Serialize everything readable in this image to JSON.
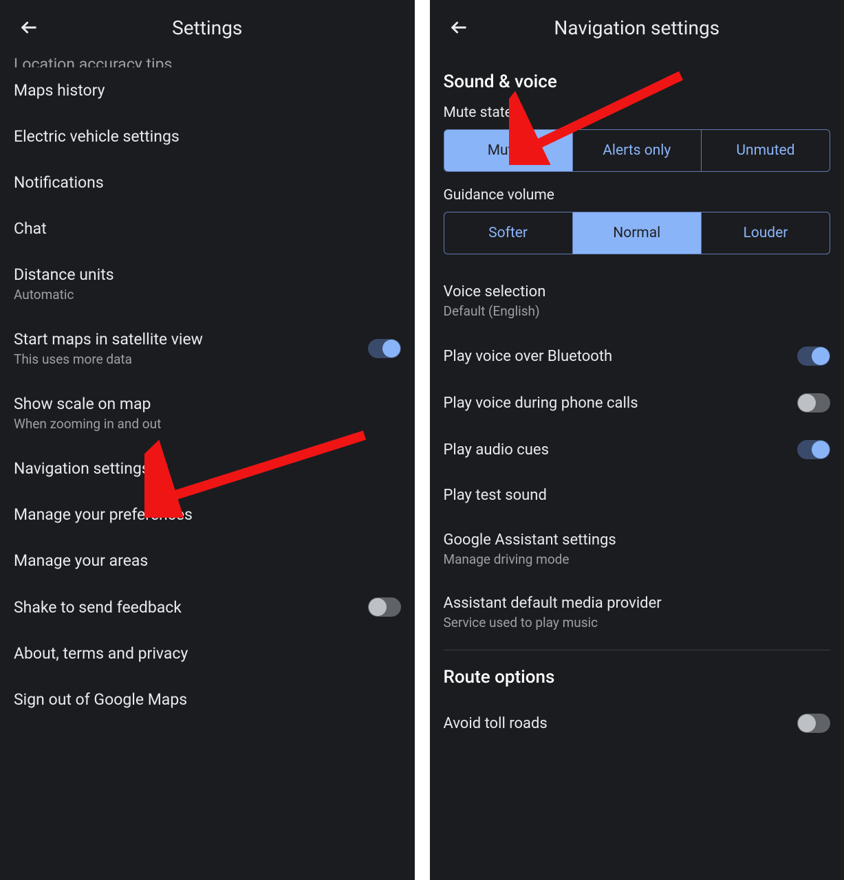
{
  "left": {
    "title": "Settings",
    "cutoff": "Location accuracy tips",
    "items": [
      {
        "label": "Maps history"
      },
      {
        "label": "Electric vehicle settings"
      },
      {
        "label": "Notifications"
      },
      {
        "label": "Chat"
      },
      {
        "label": "Distance units",
        "sub": "Automatic"
      },
      {
        "label": "Start maps in satellite view",
        "sub": "This uses more data",
        "toggle": "on"
      },
      {
        "label": "Show scale on map",
        "sub": "When zooming in and out"
      },
      {
        "label": "Navigation settings"
      },
      {
        "label": "Manage your preferences"
      },
      {
        "label": "Manage your areas"
      },
      {
        "label": "Shake to send feedback",
        "toggle": "off"
      },
      {
        "label": "About, terms and privacy"
      },
      {
        "label": "Sign out of Google Maps"
      }
    ]
  },
  "right": {
    "title": "Navigation settings",
    "sound_voice_heading": "Sound & voice",
    "mute_state_label": "Mute state",
    "mute_options": [
      "Muted",
      "Alerts only",
      "Unmuted"
    ],
    "mute_active": 0,
    "guidance_label": "Guidance volume",
    "guidance_options": [
      "Softer",
      "Normal",
      "Louder"
    ],
    "guidance_active": 1,
    "voice_selection": {
      "label": "Voice selection",
      "sub": "Default (English)"
    },
    "toggles": [
      {
        "label": "Play voice over Bluetooth",
        "state": "on"
      },
      {
        "label": "Play voice during phone calls",
        "state": "off"
      },
      {
        "label": "Play audio cues",
        "state": "on"
      }
    ],
    "play_test_sound": "Play test sound",
    "assistant_settings": {
      "label": "Google Assistant settings",
      "sub": "Manage driving mode"
    },
    "assistant_media": {
      "label": "Assistant default media provider",
      "sub": "Service used to play music"
    },
    "route_heading": "Route options",
    "avoid_tolls": {
      "label": "Avoid toll roads",
      "state": "off"
    }
  }
}
